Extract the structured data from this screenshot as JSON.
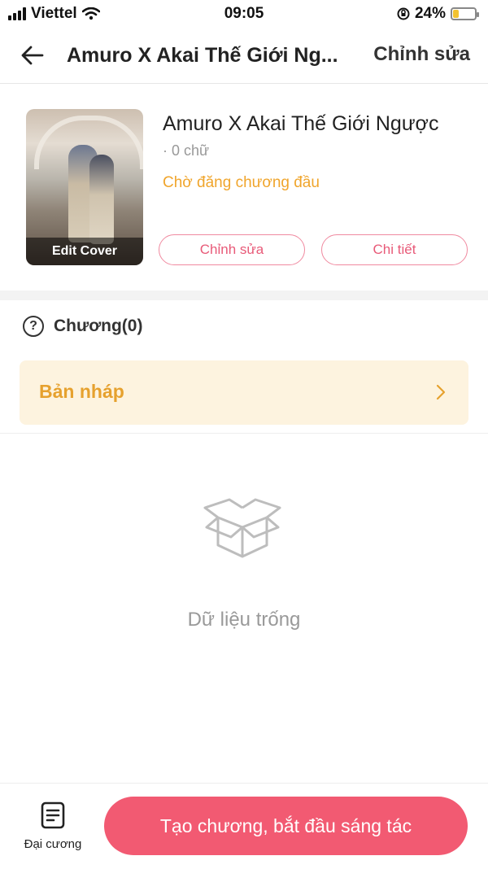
{
  "status_bar": {
    "carrier": "Viettel",
    "time": "09:05",
    "battery_percent": "24%",
    "battery_level": 0.24,
    "battery_color": "#f2c230"
  },
  "nav": {
    "back_icon": "arrow-left-icon",
    "title": "Amuro X Akai Thế Giới Ng...",
    "action_label": "Chỉnh sửa"
  },
  "book": {
    "cover_label": "Edit Cover",
    "title": "Amuro X Akai Thế Giới Ngược",
    "word_count": "· 0 chữ",
    "status": "Chờ đăng chương đầu",
    "status_color": "#f0a52c",
    "edit_button": "Chỉnh sửa",
    "detail_button": "Chi tiết"
  },
  "chapters": {
    "help_icon": "question-circle-icon",
    "label": "Chương(0)",
    "draft_label": "Bản nháp",
    "draft_icon": "chevron-right-icon"
  },
  "empty_state": {
    "icon": "empty-box-icon",
    "text": "Dữ liệu trống"
  },
  "bottom_bar": {
    "outline_icon": "document-icon",
    "outline_label": "Đại cương",
    "create_button": "Tạo chương, bắt đầu sáng tác",
    "accent_color": "#f25a72"
  }
}
